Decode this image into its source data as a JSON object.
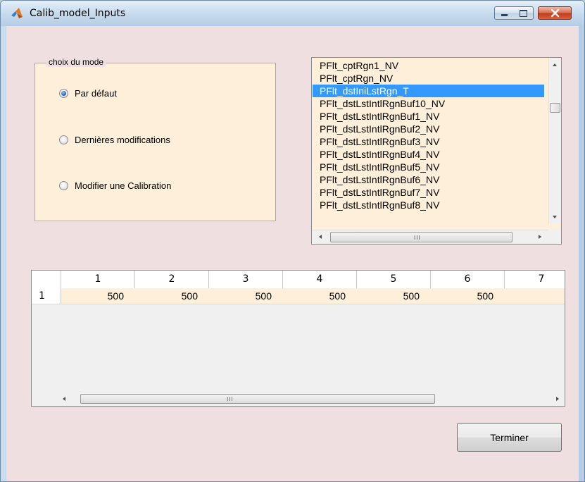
{
  "window": {
    "title": "Calib_model_Inputs",
    "icon": "matlab-icon"
  },
  "mode_group": {
    "title": "choix du mode",
    "options": [
      {
        "label": "Par défaut",
        "checked": true
      },
      {
        "label": "Dernières modifications",
        "checked": false
      },
      {
        "label": "Modifier une Calibration",
        "checked": false
      }
    ]
  },
  "listbox": {
    "items": [
      "PFlt_cptRgn1_NV",
      "PFlt_cptRgn_NV",
      "PFlt_dstIniLstRgn_T",
      "PFlt_dstLstIntlRgnBuf10_NV",
      "PFlt_dstLstIntlRgnBuf1_NV",
      "PFlt_dstLstIntlRgnBuf2_NV",
      "PFlt_dstLstIntlRgnBuf3_NV",
      "PFlt_dstLstIntlRgnBuf4_NV",
      "PFlt_dstLstIntlRgnBuf5_NV",
      "PFlt_dstLstIntlRgnBuf6_NV",
      "PFlt_dstLstIntlRgnBuf7_NV",
      "PFlt_dstLstIntlRgnBuf8_NV"
    ],
    "selected_index": 2,
    "scroll_grip": "III"
  },
  "table": {
    "columns": [
      "1",
      "2",
      "3",
      "4",
      "5",
      "6",
      "7"
    ],
    "rows": [
      {
        "header": "1",
        "cells": [
          "500",
          "500",
          "500",
          "500",
          "500",
          "500",
          "5"
        ]
      }
    ],
    "scroll_grip": "III"
  },
  "buttons": {
    "terminer": "Terminer"
  },
  "colors": {
    "client_bg": "#f0dfe0",
    "panel_bg": "#fdefd9",
    "selection": "#3399ff"
  }
}
